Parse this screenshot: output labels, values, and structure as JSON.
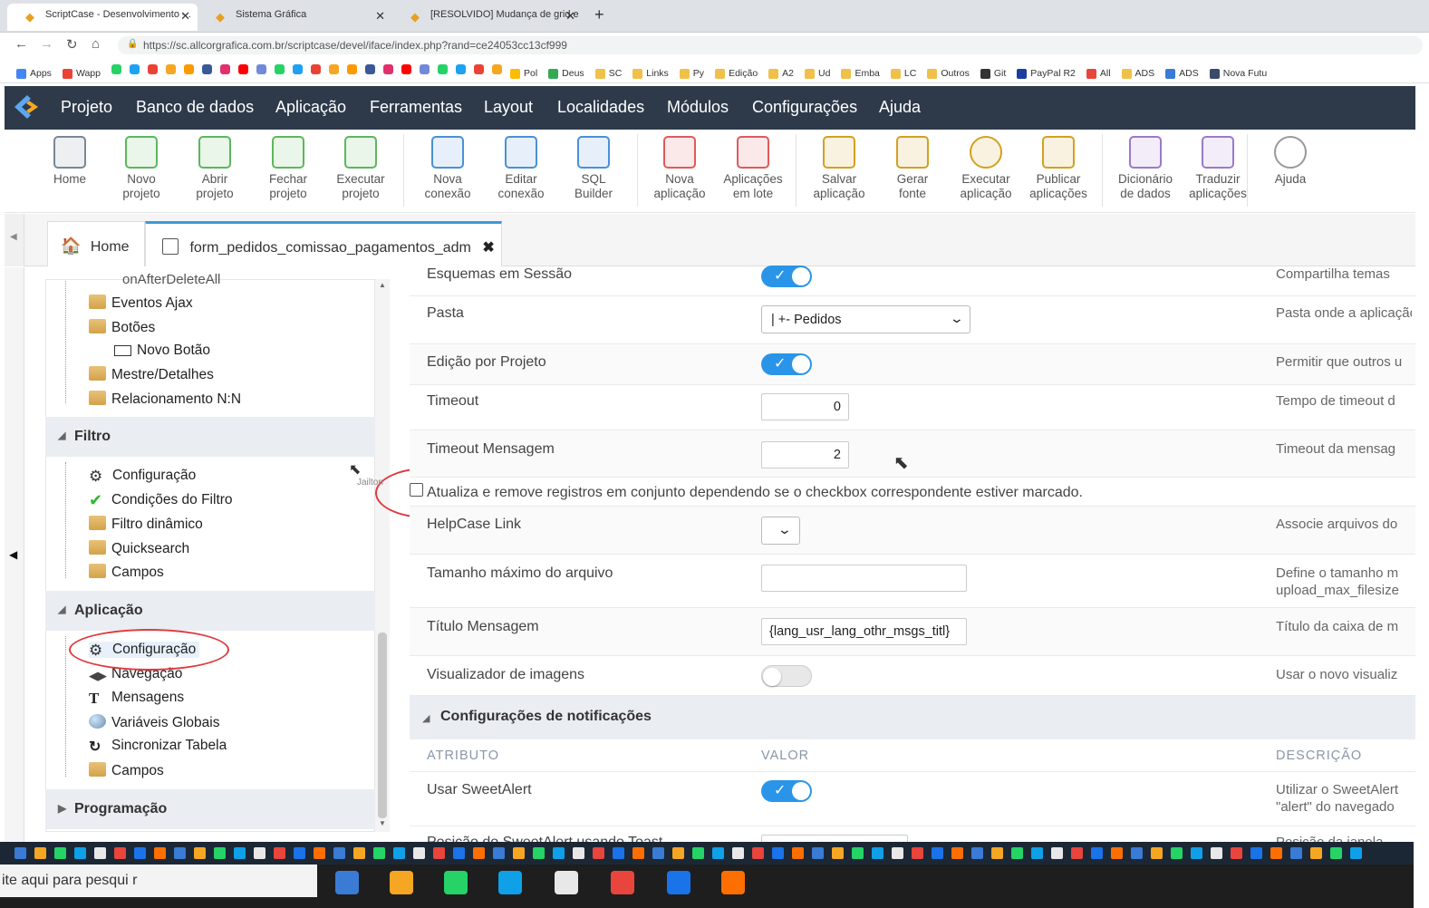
{
  "browser": {
    "tabs": [
      {
        "title": "ScriptCase - Desenvolvimento - ."
      },
      {
        "title": "Sistema Gráfica"
      },
      {
        "title": "[RESOLVIDO] Mudança de grid e"
      }
    ],
    "new_tab": "+",
    "url": "https://sc.allcorgrafica.com.br/scriptcase/devel/iface/index.php?rand=ce24053cc13cf999",
    "bookmarks": [
      "Apps",
      "Wapp",
      "Pol",
      "Deus",
      "SC",
      "Links",
      "Py",
      "Edição",
      "A2",
      "Ud",
      "Emba",
      "LC",
      "Outros",
      "Git",
      "PayPal R2",
      "All",
      "ADS",
      "ADS",
      "Nova Futu"
    ]
  },
  "menubar": {
    "items": [
      "Projeto",
      "Banco de dados",
      "Aplicação",
      "Ferramentas",
      "Layout",
      "Localidades",
      "Módulos",
      "Configurações",
      "Ajuda"
    ]
  },
  "toolbar": {
    "home": "Home",
    "novo_projeto": [
      "Novo",
      "projeto"
    ],
    "abrir_projeto": [
      "Abrir",
      "projeto"
    ],
    "fechar_projeto": [
      "Fechar",
      "projeto"
    ],
    "executar_projeto": [
      "Executar",
      "projeto"
    ],
    "nova_conexao": [
      "Nova",
      "conexão"
    ],
    "editar_conexao": [
      "Editar",
      "conexão"
    ],
    "sql_builder": [
      "SQL",
      "Builder"
    ],
    "nova_aplicacao": [
      "Nova",
      "aplicação"
    ],
    "aplicacoes_lote": [
      "Aplicações",
      "em lote"
    ],
    "salvar_aplicacao": [
      "Salvar",
      "aplicação"
    ],
    "gerar_fonte": [
      "Gerar",
      "fonte"
    ],
    "executar_aplicacao": [
      "Executar",
      "aplicação"
    ],
    "publicar_aplicacoes": [
      "Publicar",
      "aplicações"
    ],
    "dicionario": [
      "Dicionário",
      "de dados"
    ],
    "traduzir": [
      "Traduzir",
      "aplicações"
    ],
    "ajuda": "Ajuda"
  },
  "app_tabs": {
    "home": "Home",
    "current": "form_pedidos_comissao_pagamentos_adm"
  },
  "tree": {
    "top_partial": "onAfterDeleteAll",
    "events": [
      "Eventos Ajax",
      "Botões",
      "Novo Botão",
      "Mestre/Detalhes",
      "Relacionamento N:N"
    ],
    "filtro": {
      "title": "Filtro",
      "items": [
        "Configuração",
        "Condições do Filtro",
        "Filtro dinâmico",
        "Quicksearch",
        "Campos"
      ]
    },
    "aplicacao": {
      "title": "Aplicação",
      "items": [
        "Configuração",
        "Navegação",
        "Mensagens",
        "Variáveis Globais",
        "Sincronizar Tabela",
        "Campos"
      ]
    },
    "programacao": {
      "title": "Programação"
    }
  },
  "cursor_label": "Jailton",
  "settings": {
    "esquemas": {
      "label": "Esquemas em Sessão",
      "desc": "Compartilha temas",
      "on": true
    },
    "pasta": {
      "label": "Pasta",
      "value": "|  +- Pedidos",
      "desc": "Pasta onde a aplicação"
    },
    "edicao": {
      "label": "Edição por Projeto",
      "desc": "Permitir que outros u",
      "on": true
    },
    "timeout": {
      "label": "Timeout",
      "value": "0",
      "desc": "Tempo de timeout d"
    },
    "timeout_msg": {
      "label": "Timeout Mensagem",
      "value": "2",
      "desc": "Timeout da mensag"
    },
    "checkbox_row": {
      "label": "Atualiza e remove registros em conjunto dependendo se o checkbox correspondente estiver marcado."
    },
    "helpcase": {
      "label": "HelpCase Link",
      "desc": "Associe arquivos do"
    },
    "tamanho": {
      "label": "Tamanho máximo do arquivo",
      "value": "",
      "desc": [
        "Define o tamanho m",
        "upload_max_filesize"
      ]
    },
    "titulo_msg": {
      "label": "Título Mensagem",
      "value": "{lang_usr_lang_othr_msgs_titl}",
      "desc": "Título da caixa de m"
    },
    "visualizador": {
      "label": "Visualizador de imagens",
      "desc": "Usar o novo visualiz",
      "on": false
    }
  },
  "notifications": {
    "title": "Configurações de notificações",
    "headers": {
      "atributo": "ATRIBUTO",
      "valor": "VALOR",
      "descricao": "DESCRIÇÃO"
    },
    "sweetalert": {
      "label": "Usar SweetAlert",
      "desc": [
        "Utilizar o SweetAlert",
        "\"alert\" do navegado"
      ],
      "on": true
    },
    "partial": {
      "label": "Posição do SweetAlert usando Toast",
      "desc": "Posição da janela"
    }
  },
  "taskbar": {
    "search_text": "ite aqui para pesqui   r"
  },
  "colors": {
    "menubar": "#2e3a4a",
    "toggle_on": "#2a95e8",
    "annotation": "#e0393e",
    "tab_accent": "#3a9ad9"
  }
}
